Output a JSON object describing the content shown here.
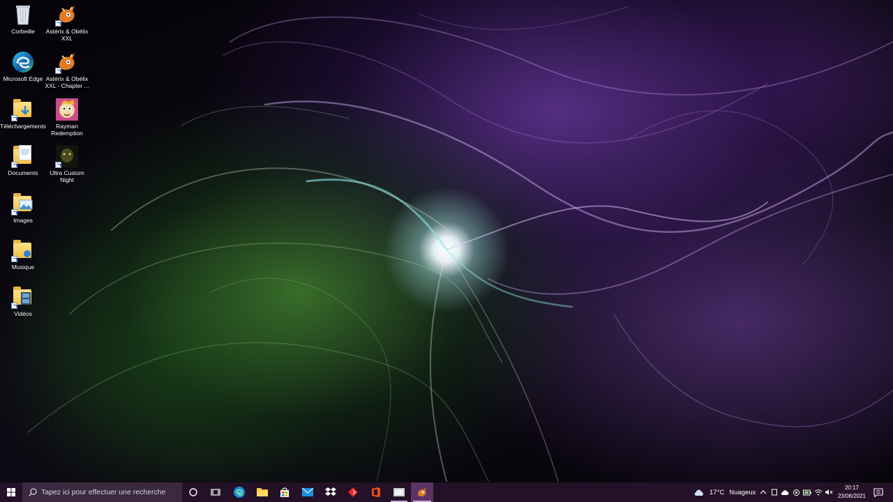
{
  "desktop": {
    "icons": [
      {
        "name": "recycle-bin",
        "label": "Corbeille"
      },
      {
        "name": "edge",
        "label": "Microsoft Edge"
      },
      {
        "name": "downloads",
        "label": "Téléchargements"
      },
      {
        "name": "documents",
        "label": "Documents"
      },
      {
        "name": "images",
        "label": "Images"
      },
      {
        "name": "music",
        "label": "Musique"
      },
      {
        "name": "videos",
        "label": "Vidéos"
      },
      {
        "name": "asterix-xxl",
        "label": "Astérix & Obélix XXL"
      },
      {
        "name": "asterix-xxl-chapter",
        "label": "Astérix & Obélix XXL - Chapter ..."
      },
      {
        "name": "rayman-redemption",
        "label": "Rayman Redemption"
      },
      {
        "name": "ultra-custom-night",
        "label": "Ultra Custom Night"
      }
    ]
  },
  "taskbar": {
    "search_placeholder": "Tapez ici pour effectuer une recherche",
    "pinned": [
      "cortana",
      "task-view",
      "edge",
      "file-explorer",
      "microsoft-store",
      "mail",
      "dropbox",
      "red-app",
      "office",
      "running-app",
      "asterix-app"
    ],
    "weather": {
      "temperature": "17°C",
      "condition": "Nuageux"
    },
    "clock": {
      "time": "20:17",
      "date": "23/06/2021"
    }
  },
  "colors": {
    "taskbar": "#241127",
    "search_box": "#3b2a3f",
    "accent": "#c9a9d9"
  }
}
